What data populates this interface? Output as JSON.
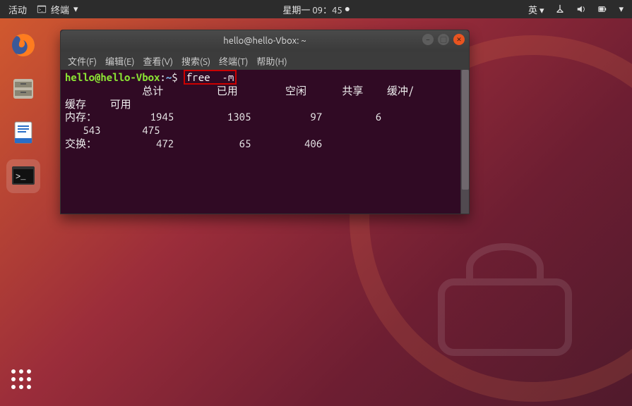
{
  "topbar": {
    "activities": "活动",
    "app_name": "终端",
    "clock": "星期一 09：45",
    "ime": "英",
    "ime_caret": "▾",
    "power_triangle": "▾"
  },
  "window": {
    "title": "hello@hello-Vbox: ~"
  },
  "menubar": {
    "file": "文件(F)",
    "edit": "编辑(E)",
    "view": "查看(V)",
    "search": "搜索(S)",
    "terminal": "终端(T)",
    "help": "帮助(H)"
  },
  "terminal": {
    "prompt_user": "hello@hello-Vbox",
    "prompt_sep": ":",
    "prompt_path": "~",
    "prompt_dollar": "$",
    "command": "free  -m",
    "header_line": "             总计         已用        空闲      共享    缓冲/",
    "line_cache": "缓存    可用",
    "line_mem": "内存：         1945         1305          97         6     ",
    "line_memw": "   543       475",
    "line_swap": "交换：          472           65         406"
  }
}
